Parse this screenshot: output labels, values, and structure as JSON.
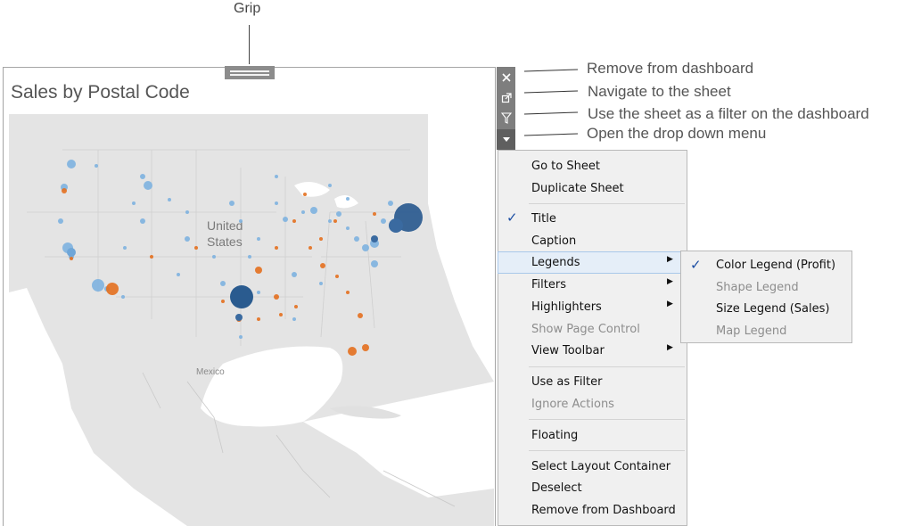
{
  "grip_label": "Grip",
  "sheet": {
    "title": "Sales by Postal Code"
  },
  "map": {
    "country_label": "United States",
    "country_line1": "United",
    "country_line2": "States",
    "mexico_label": "Mexico"
  },
  "callouts": {
    "remove": "Remove from dashboard",
    "navigate": "Navigate to the sheet",
    "filter": "Use the sheet as a filter on the dashboard",
    "dropdown": "Open the drop down menu"
  },
  "toolbar": {
    "remove_icon": "close-icon",
    "goto_icon": "external-link-icon",
    "filter_icon": "funnel-icon",
    "menu_icon": "caret-down-icon"
  },
  "menu": {
    "items": [
      {
        "label": "Go to Sheet",
        "enabled": true
      },
      {
        "label": "Duplicate Sheet",
        "enabled": true
      },
      {
        "label": "Title",
        "enabled": true,
        "checked": true
      },
      {
        "label": "Caption",
        "enabled": true
      },
      {
        "label": "Legends",
        "enabled": true,
        "submenu": true,
        "highlighted": true
      },
      {
        "label": "Filters",
        "enabled": true,
        "submenu": true
      },
      {
        "label": "Highlighters",
        "enabled": true,
        "submenu": true
      },
      {
        "label": "Show Page Control",
        "enabled": false
      },
      {
        "label": "View Toolbar",
        "enabled": true,
        "submenu": true
      },
      {
        "label": "Use as Filter",
        "enabled": true
      },
      {
        "label": "Ignore Actions",
        "enabled": false
      },
      {
        "label": "Floating",
        "enabled": true
      },
      {
        "label": "Select Layout Container",
        "enabled": true
      },
      {
        "label": "Deselect",
        "enabled": true
      },
      {
        "label": "Remove from Dashboard",
        "enabled": true
      }
    ]
  },
  "submenu": {
    "items": [
      {
        "label": "Color Legend (Profit)",
        "enabled": true,
        "checked": true
      },
      {
        "label": "Shape Legend",
        "enabled": false
      },
      {
        "label": "Size Legend (Sales)",
        "enabled": true
      },
      {
        "label": "Map Legend",
        "enabled": false
      }
    ]
  },
  "colors": {
    "positive": "#5b9bd5",
    "negative": "#e06b24",
    "large": "#2a5b8f",
    "toolbar": "#7e7e7e",
    "highlight": "#e5eef8"
  }
}
